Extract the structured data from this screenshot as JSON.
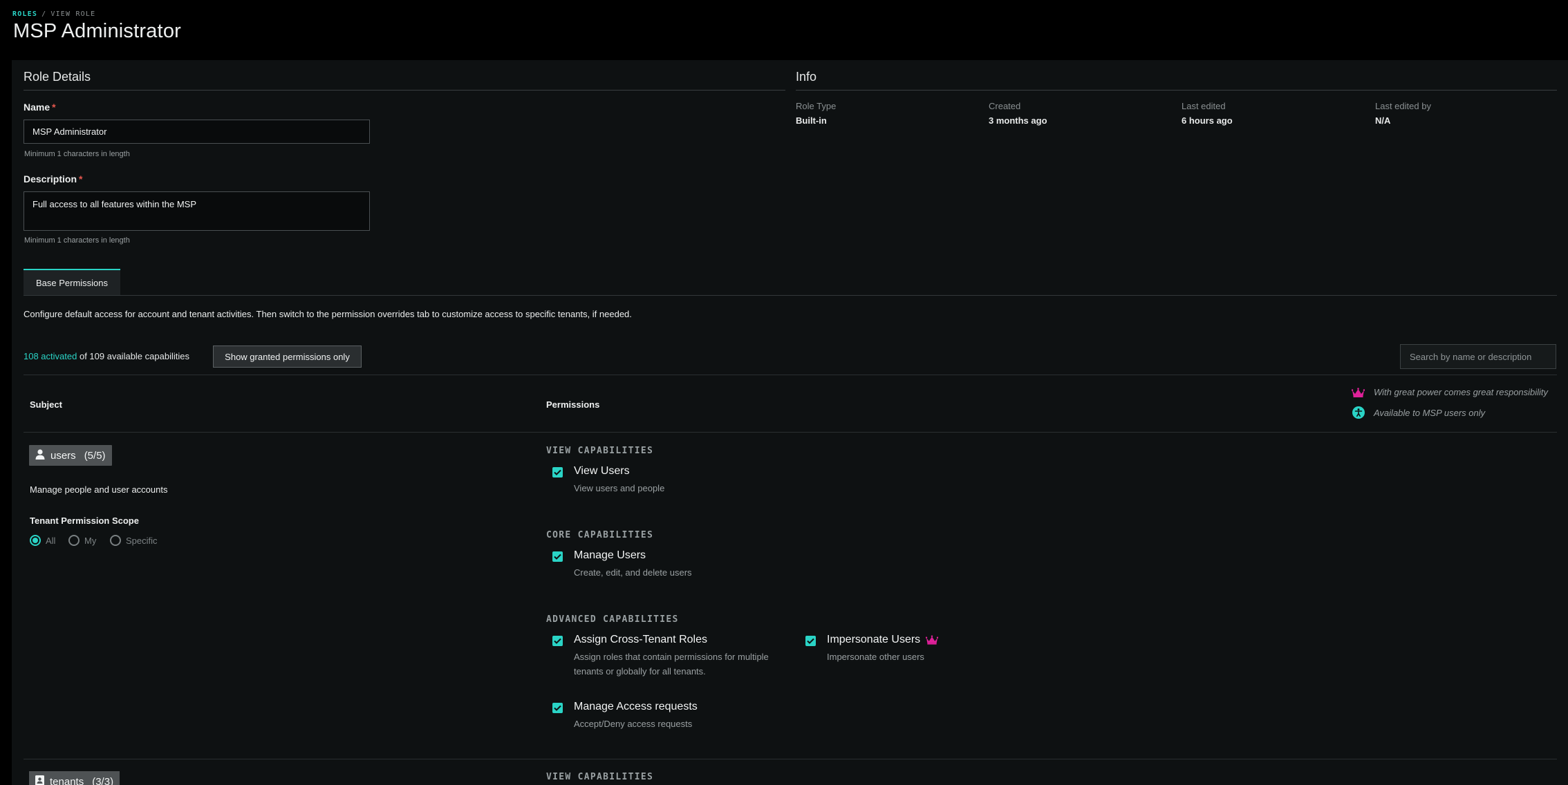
{
  "breadcrumb": {
    "root": "ROLES",
    "separator": "/",
    "current": "VIEW ROLE"
  },
  "page": {
    "title": "MSP Administrator"
  },
  "role_details": {
    "heading": "Role Details",
    "name_label": "Name",
    "required_mark": "*",
    "name_value": "MSP Administrator",
    "name_hint": "Minimum 1 characters in length",
    "description_label": "Description",
    "description_value": "Full access to all features within the MSP",
    "description_hint": "Minimum 1 characters in length"
  },
  "info": {
    "heading": "Info",
    "role_type_label": "Role Type",
    "role_type_value": "Built-in",
    "created_label": "Created",
    "created_value": "3 months ago",
    "last_edited_label": "Last edited",
    "last_edited_value": "6 hours ago",
    "last_edited_by_label": "Last edited by",
    "last_edited_by_value": "N/A"
  },
  "tabs": {
    "base_permissions": "Base Permissions"
  },
  "permissions": {
    "intro": "Configure default access for account and tenant activities. Then switch to the permission overrides tab to customize access to specific tenants, if needed.",
    "activated": "108 activated",
    "available": "of 109 available capabilities",
    "toggle_label": "Show granted permissions only",
    "search_placeholder": "Search by name or description",
    "subject_header": "Subject",
    "permissions_header": "Permissions",
    "legend": {
      "power": "With great power comes great responsibility",
      "msp_only": "Available to MSP users only"
    },
    "colors": {
      "accent": "#2ad4c6",
      "power": "#e0219a"
    }
  },
  "users": {
    "subject": "users",
    "count": "(5/5)",
    "icon": "person-icon",
    "description": "Manage people and user accounts",
    "scope_title": "Tenant Permission Scope",
    "scope_all": "All",
    "scope_my": "My",
    "scope_specific": "Specific",
    "scope_selected": "All",
    "view_title": "VIEW CAPABILITIES",
    "view_users_name": "View Users",
    "view_users_desc": "View users and people",
    "core_title": "CORE CAPABILITIES",
    "manage_users_name": "Manage Users",
    "manage_users_desc": "Create, edit, and delete users",
    "advanced_title": "ADVANCED CAPABILITIES",
    "cross_tenant_name": "Assign Cross-Tenant Roles",
    "cross_tenant_desc": "Assign roles that contain permissions for multiple tenants or globally for all tenants.",
    "impersonate_name": "Impersonate Users",
    "impersonate_desc": "Impersonate other users",
    "access_requests_name": "Manage Access requests",
    "access_requests_desc": "Accept/Deny access requests"
  },
  "tenants": {
    "subject": "tenants",
    "count": "(3/3)",
    "view_title": "VIEW CAPABILITIES"
  }
}
